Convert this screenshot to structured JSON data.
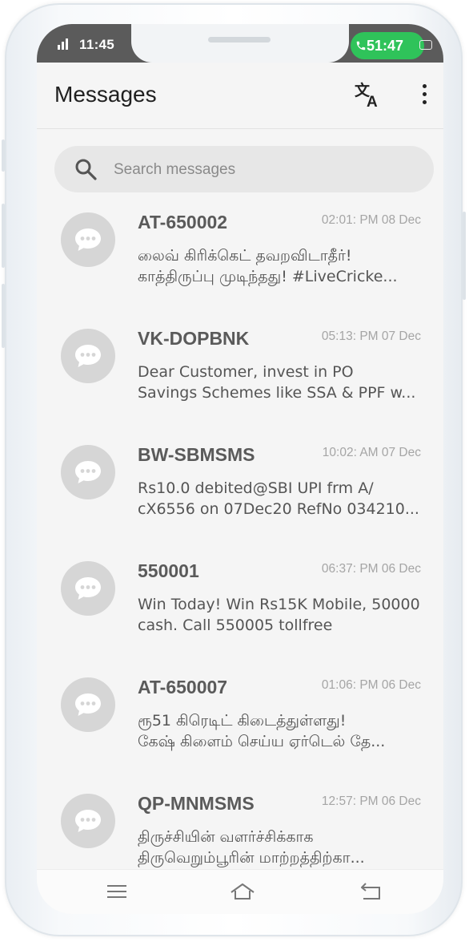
{
  "status_bar": {
    "time": "11:45",
    "call_timer": "51:47",
    "icons": [
      "signal-icon",
      "call-phone-icon",
      "battery-icon"
    ]
  },
  "app_bar": {
    "title": "Messages",
    "icons": [
      "translate-icon",
      "more-vertical-icon"
    ]
  },
  "search": {
    "placeholder": "Search messages"
  },
  "messages": [
    {
      "sender": "AT-650002",
      "date": "02:01: PM 08 Dec",
      "line1": "லைவ் கிரிக்கெட் தவறவிடாதீர்!",
      "line2": "காத்திருப்பு முடிந்தது! #LiveCricke..."
    },
    {
      "sender": "VK-DOPBNK",
      "date": "05:13: PM 07 Dec",
      "line1": "Dear Customer, invest in PO",
      "line2": "Savings Schemes like SSA & PPF w..."
    },
    {
      "sender": "BW-SBMSMS",
      "date": "10:02: AM 07 Dec",
      "line1": "Rs10.0 debited@SBI UPI frm A/",
      "line2": "cX6556 on 07Dec20 RefNo 034210..."
    },
    {
      "sender": "550001",
      "date": "06:37: PM 06 Dec",
      "line1": "Win Today! Win Rs15K Mobile, 50000",
      "line2": "cash. Call 550005 tollfree"
    },
    {
      "sender": "AT-650007",
      "date": "01:06: PM 06 Dec",
      "line1": "ரூ51 கிரெடிட் கிடைத்துள்ளது!",
      "line2": "கேஷ் கிளைம் செய்ய ஏர்டெல் தே..."
    },
    {
      "sender": "QP-MNMSMS",
      "date": "12:57: PM 06 Dec",
      "line1": "திருச்சியின் வளர்ச்சிக்காக",
      "line2": "திருவெறும்பூரின் மாற்றத்திற்கா..."
    }
  ],
  "nav_bar": {
    "icons": [
      "menu-icon",
      "home-icon",
      "back-icon"
    ]
  },
  "colors": {
    "avatar": "#d6d6d6",
    "call_pill": "#2fc35a",
    "status_bar": "#5b5b5b",
    "search_bg": "#e7e7e7"
  }
}
